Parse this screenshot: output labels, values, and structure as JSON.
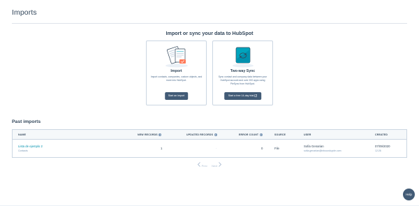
{
  "page": {
    "title": "Imports"
  },
  "intro": {
    "heading": "Import or sync your data to HubSpot"
  },
  "cards": [
    {
      "title": "Import",
      "description": "Import contacts, companies, custom objects, and more into HubSpot.",
      "button": "Start an import",
      "icon": "document-import-illustration"
    },
    {
      "title": "Two-way Sync",
      "description": "Sync contact and company data between your HubSpot account and over 200 apps using PieSync from HubSpot.",
      "button": "Start a free 14-day trial",
      "icon": "sync-box-illustration"
    }
  ],
  "past_imports": {
    "heading": "Past imports",
    "columns": [
      "NAME",
      "NEW RECORDS",
      "UPDATED RECORDS",
      "ERROR COUNT",
      "SOURCE",
      "USER",
      "CREATED"
    ],
    "rows": [
      {
        "name": "Lista de ejemplo 2",
        "object": "Contacts",
        "new_records": "1",
        "updated_records": "-",
        "error_count": "0",
        "source": "File",
        "user_name": "Sofia Genarian",
        "user_email": "sofia.genarian@inboundcycle.com",
        "created_date": "07/09/2020",
        "created_time": "12:26"
      }
    ]
  },
  "pagination": {
    "prev": "Prev",
    "next": "Next"
  },
  "help": {
    "label": "Help"
  },
  "colors": {
    "primary_button": "#425b76",
    "link": "#0091ae",
    "text": "#33475b",
    "accent_orange": "#ff7a59"
  }
}
